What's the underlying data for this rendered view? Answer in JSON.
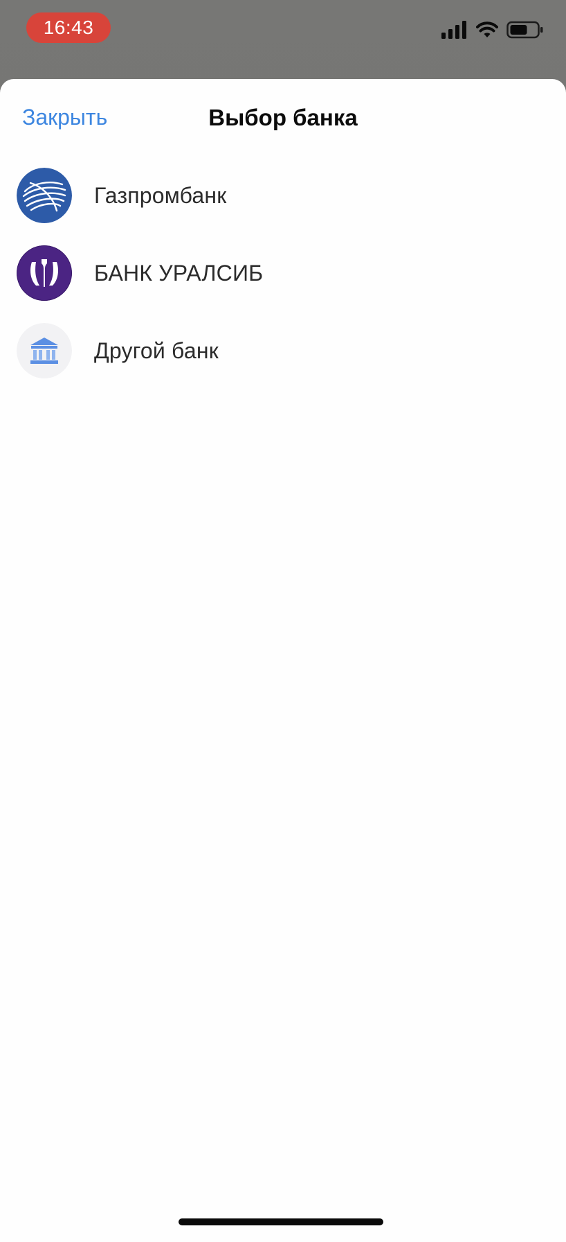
{
  "status_bar": {
    "time": "16:43",
    "time_pill_color": "#d8443a",
    "icons": [
      "cellular-signal-icon",
      "wifi-icon",
      "battery-icon"
    ]
  },
  "sheet": {
    "close_label": "Закрыть",
    "title": "Выбор банка"
  },
  "banks": [
    {
      "name": "Газпромбанк",
      "logo": "gazprombank-logo-icon",
      "color": "#2d5ba8"
    },
    {
      "name": "БАНК УРАЛСИБ",
      "logo": "uralsib-logo-icon",
      "color": "#4b2483"
    },
    {
      "name": "Другой банк",
      "logo": "bank-building-icon",
      "color": "#5b8fe3"
    }
  ],
  "colors": {
    "accent": "#3d86e0",
    "sheet_background": "#fefefe",
    "dimmed_background": "#757573"
  }
}
